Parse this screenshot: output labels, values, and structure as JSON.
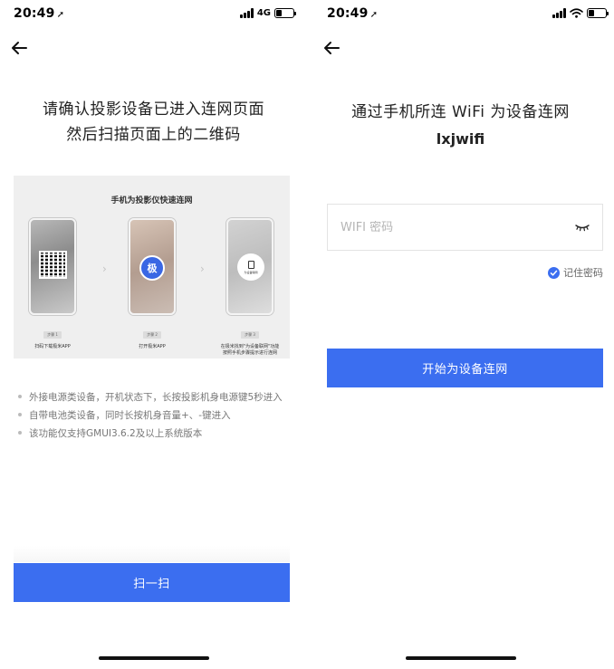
{
  "left_screen": {
    "status": {
      "time": "20:49",
      "network": "4G"
    },
    "title_line1": "请确认投影设备已进入连网页面",
    "title_line2": "然后扫描页面上的二维码",
    "guide": {
      "caption": "手机为投影仪快速连网",
      "app_badge": "极",
      "steps": [
        {
          "tag": "步骤 1",
          "desc": "扫码下载极米APP"
        },
        {
          "tag": "步骤 2",
          "desc": "打开极米APP"
        },
        {
          "tag": "步骤 3",
          "desc": "在极米找到\"为设备联网\"功能 按照手机步骤提示进行连网"
        }
      ]
    },
    "tips": [
      "外接电源类设备，开机状态下，长按投影机身电源键5秒进入",
      "自带电池类设备，同时长按机身音量+、-键进入",
      "该功能仅支持GMUI3.6.2及以上系统版本"
    ],
    "scan_button_label": "扫一扫"
  },
  "right_screen": {
    "status": {
      "time": "20:49"
    },
    "title": "通过手机所连 WiFi 为设备连网",
    "ssid": "lxjwifi",
    "password_placeholder": "WIFI 密码",
    "password_value": "",
    "remember_label": "记住密码",
    "remember_checked": true,
    "connect_button_label": "开始为设备连网"
  },
  "colors": {
    "accent": "#3b6ef0",
    "text": "#222222",
    "muted": "#777777"
  },
  "icons": [
    "back-arrow-icon",
    "location-arrow-icon",
    "signal-icon",
    "wifi-icon",
    "battery-icon",
    "eye-closed-icon",
    "check-icon"
  ]
}
